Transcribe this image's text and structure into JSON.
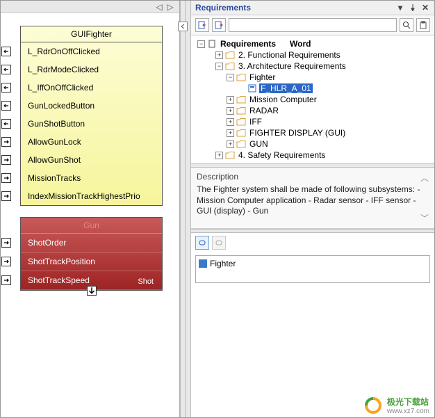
{
  "left": {
    "gui_block": {
      "title": "GUIFighter",
      "ports": [
        {
          "label": "L_RdrOnOffClicked",
          "dir": "in"
        },
        {
          "label": "L_RdrModeClicked",
          "dir": "in"
        },
        {
          "label": "L_IffOnOffClicked",
          "dir": "in"
        },
        {
          "label": "GunLockedButton",
          "dir": "in"
        },
        {
          "label": "GunShotButton",
          "dir": "in"
        },
        {
          "label": "AllowGunLock",
          "dir": "out"
        },
        {
          "label": "AllowGunShot",
          "dir": "out"
        },
        {
          "label": "MissionTracks",
          "dir": "out"
        },
        {
          "label": "IndexMissionTrackHighestPrio",
          "dir": "out"
        }
      ]
    },
    "gun_block": {
      "title": "Gun",
      "ports": [
        {
          "label": "ShotOrder",
          "dir": "out"
        },
        {
          "label": "ShotTrackPosition",
          "dir": "out"
        },
        {
          "label": "ShotTrackSpeed",
          "dir": "out"
        }
      ],
      "bottom_port": "Shot"
    }
  },
  "right": {
    "panel_title": "Requirements",
    "search_placeholder": "",
    "tree_header": {
      "col1": "Requirements",
      "col2": "Word"
    },
    "tree": [
      {
        "depth": 1,
        "expander": "+",
        "icon": "folder",
        "label": "2. Functional Requirements"
      },
      {
        "depth": 1,
        "expander": "-",
        "icon": "folder",
        "label": "3. Architecture Requirements"
      },
      {
        "depth": 2,
        "expander": "-",
        "icon": "folder",
        "label": "Fighter"
      },
      {
        "depth": 3,
        "expander": "",
        "icon": "req",
        "label": "F_HLR_A_01",
        "selected": true
      },
      {
        "depth": 2,
        "expander": "+",
        "icon": "folder",
        "label": "Mission Computer"
      },
      {
        "depth": 2,
        "expander": "+",
        "icon": "folder",
        "label": "RADAR"
      },
      {
        "depth": 2,
        "expander": "+",
        "icon": "folder",
        "label": "IFF"
      },
      {
        "depth": 2,
        "expander": "+",
        "icon": "folder",
        "label": "FIGHTER DISPLAY (GUI)"
      },
      {
        "depth": 2,
        "expander": "+",
        "icon": "folder",
        "label": "GUN"
      },
      {
        "depth": 1,
        "expander": "+",
        "icon": "folder",
        "label": "4. Safety Requirements"
      }
    ],
    "description": {
      "title": "Description",
      "body": "The Fighter system shall be made of following subsystems: - Mission Computer application - Radar sensor - IFF sensor - GUI (display) - Gun"
    },
    "links": [
      {
        "label": "Fighter"
      }
    ]
  },
  "watermark": {
    "title": "极光下载站",
    "sub": "www.xz7.com"
  }
}
